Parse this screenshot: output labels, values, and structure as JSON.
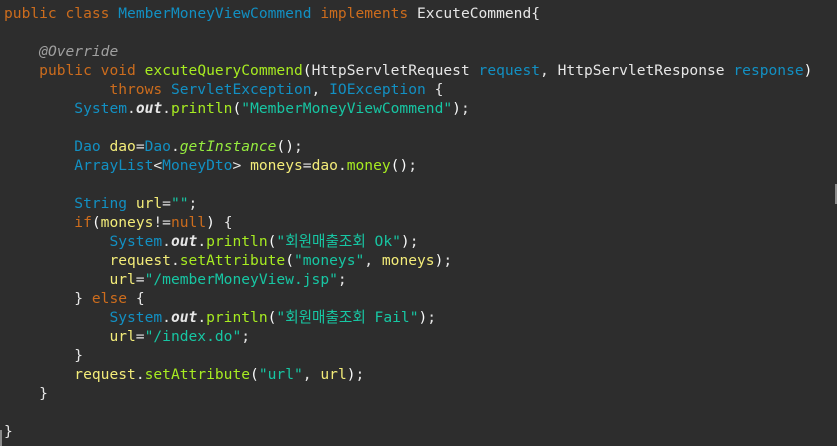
{
  "editor": {
    "lines": [
      "public class MemberMoneyViewCommend implements ExcuteCommend{",
      "",
      "    @Override",
      "    public void excuteQueryCommend(HttpServletRequest request, HttpServletResponse response)",
      "            throws ServletException, IOException {",
      "        System.out.println(\"MemberMoneyViewCommend\");",
      "",
      "        Dao dao=Dao.getInstance();",
      "        ArrayList<MoneyDto> moneys=dao.money();",
      "",
      "        String url=\"\";",
      "        if(moneys!=null) {",
      "            System.out.println(\"회원매출조회 Ok\");",
      "            request.setAttribute(\"moneys\", moneys);",
      "            url=\"/memberMoneyView.jsp\";",
      "        } else {",
      "            System.out.println(\"회원매출조회 Fail\");",
      "            url=\"/index.do\";",
      "        }",
      "        request.setAttribute(\"url\", url);",
      "    }",
      "",
      "}"
    ]
  },
  "colors": {
    "background": "#2d2d2d",
    "keyword": "#cc6c1d",
    "type": "#1290c3",
    "string": "#17c6a3",
    "variable": "#f3ec79",
    "method": "#a7ec21",
    "annotation": "#a0a0a0"
  }
}
